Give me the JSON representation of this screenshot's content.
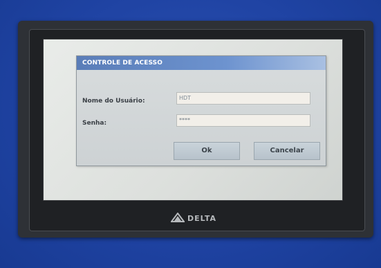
{
  "dialog": {
    "title": "CONTROLE DE ACESSO",
    "username_label": "Nome do Usuário:",
    "username_value": "HDT",
    "password_label": "Senha:",
    "password_value": "****",
    "ok_label": "Ok",
    "cancel_label": "Cancelar"
  },
  "device": {
    "brand": "DELTA",
    "logo_icon": "delta-triangle-icon"
  },
  "colors": {
    "wall": "#1f43a3",
    "bezel": "#2e3136",
    "title_bar": "#6d93cf",
    "screen_bg": "#e4e7e4"
  }
}
